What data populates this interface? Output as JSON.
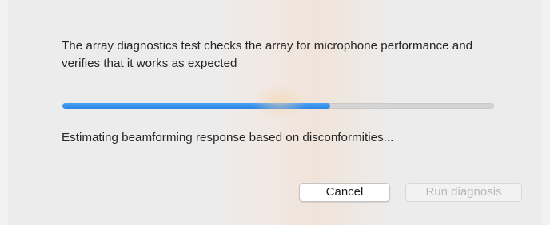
{
  "dialog": {
    "description": "The array diagnostics test checks the array for microphone performance and verifies that it works as expected",
    "progress": {
      "percent": 62,
      "color": "#3a93ee"
    },
    "status": "Estimating beamforming response based on disconformities...",
    "buttons": {
      "cancel_label": "Cancel",
      "run_label": "Run diagnosis",
      "run_enabled": false
    }
  }
}
